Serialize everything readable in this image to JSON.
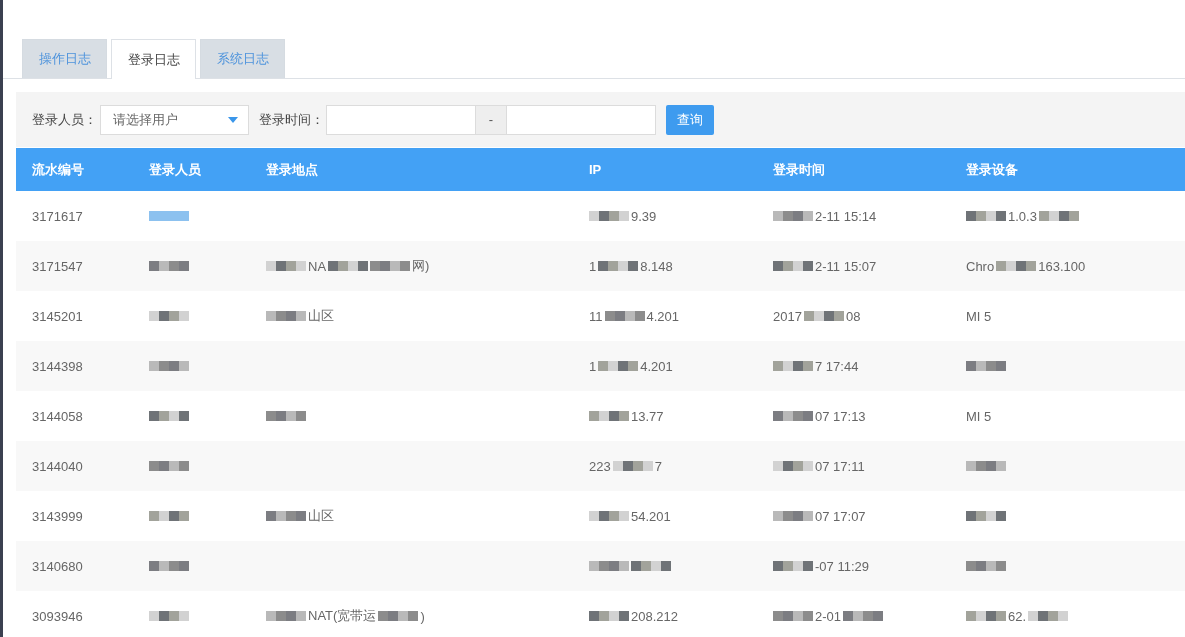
{
  "tabs": [
    {
      "label": "操作日志",
      "selected": false
    },
    {
      "label": "登录日志",
      "selected": true
    },
    {
      "label": "系统日志",
      "selected": false
    }
  ],
  "filters": {
    "user": {
      "label": "登录人员：",
      "placeholder": "请选择用户"
    },
    "time": {
      "label": "登录时间：",
      "separator": "-"
    },
    "search_button": "查询"
  },
  "table": {
    "columns": [
      "流水编号",
      "登录人员",
      "登录地点",
      "IP",
      "登录时间",
      "登录设备"
    ],
    "rows": [
      {
        "cells": [
          [
            {
              "kind": "text",
              "text": "3171617"
            }
          ],
          [
            {
              "kind": "link_mosaic"
            }
          ],
          [],
          [
            {
              "kind": "mosaic"
            },
            {
              "kind": "text",
              "text": "9.39"
            }
          ],
          [
            {
              "kind": "mosaic"
            },
            {
              "kind": "text",
              "text": "2-11 15:14"
            }
          ],
          [
            {
              "kind": "mosaic"
            },
            {
              "kind": "text",
              "text": "1.0.3"
            },
            {
              "kind": "mosaic"
            }
          ]
        ]
      },
      {
        "cells": [
          [
            {
              "kind": "text",
              "text": "3171547"
            }
          ],
          [
            {
              "kind": "mosaic"
            }
          ],
          [
            {
              "kind": "mosaic"
            },
            {
              "kind": "text",
              "text": "NA"
            },
            {
              "kind": "mosaic"
            },
            {
              "kind": "mosaic"
            },
            {
              "kind": "text",
              "text": "网)"
            }
          ],
          [
            {
              "kind": "text",
              "text": "1"
            },
            {
              "kind": "mosaic"
            },
            {
              "kind": "text",
              "text": "8.148"
            }
          ],
          [
            {
              "kind": "mosaic"
            },
            {
              "kind": "text",
              "text": "2-11 15:07"
            }
          ],
          [
            {
              "kind": "text",
              "text": "Chro"
            },
            {
              "kind": "mosaic"
            },
            {
              "kind": "text",
              "text": "163.100"
            }
          ]
        ]
      },
      {
        "cells": [
          [
            {
              "kind": "text",
              "text": "3145201"
            }
          ],
          [
            {
              "kind": "mosaic"
            }
          ],
          [
            {
              "kind": "mosaic"
            },
            {
              "kind": "text",
              "text": "山区"
            }
          ],
          [
            {
              "kind": "text",
              "text": "11"
            },
            {
              "kind": "mosaic"
            },
            {
              "kind": "text",
              "text": "4.201"
            }
          ],
          [
            {
              "kind": "text",
              "text": "2017"
            },
            {
              "kind": "mosaic"
            },
            {
              "kind": "text",
              "text": "08"
            }
          ],
          [
            {
              "kind": "text",
              "text": "MI 5"
            }
          ]
        ]
      },
      {
        "cells": [
          [
            {
              "kind": "text",
              "text": "3144398"
            }
          ],
          [
            {
              "kind": "mosaic"
            }
          ],
          [],
          [
            {
              "kind": "text",
              "text": "1"
            },
            {
              "kind": "mosaic"
            },
            {
              "kind": "text",
              "text": "4.201"
            }
          ],
          [
            {
              "kind": "mosaic"
            },
            {
              "kind": "text",
              "text": "7 17:44"
            }
          ],
          [
            {
              "kind": "mosaic"
            }
          ]
        ]
      },
      {
        "cells": [
          [
            {
              "kind": "text",
              "text": "3144058"
            }
          ],
          [
            {
              "kind": "mosaic"
            }
          ],
          [
            {
              "kind": "mosaic"
            }
          ],
          [
            {
              "kind": "mosaic"
            },
            {
              "kind": "text",
              "text": "13.77"
            }
          ],
          [
            {
              "kind": "mosaic"
            },
            {
              "kind": "text",
              "text": "07 17:13"
            }
          ],
          [
            {
              "kind": "text",
              "text": "MI 5"
            }
          ]
        ]
      },
      {
        "cells": [
          [
            {
              "kind": "text",
              "text": "3144040"
            }
          ],
          [
            {
              "kind": "mosaic"
            }
          ],
          [],
          [
            {
              "kind": "text",
              "text": "223"
            },
            {
              "kind": "mosaic"
            },
            {
              "kind": "text",
              "text": "7"
            }
          ],
          [
            {
              "kind": "mosaic"
            },
            {
              "kind": "text",
              "text": "07 17:11"
            }
          ],
          [
            {
              "kind": "mosaic"
            }
          ]
        ]
      },
      {
        "cells": [
          [
            {
              "kind": "text",
              "text": "3143999"
            }
          ],
          [
            {
              "kind": "mosaic"
            }
          ],
          [
            {
              "kind": "mosaic"
            },
            {
              "kind": "text",
              "text": "山区"
            }
          ],
          [
            {
              "kind": "mosaic"
            },
            {
              "kind": "text",
              "text": "54.201"
            }
          ],
          [
            {
              "kind": "mosaic"
            },
            {
              "kind": "text",
              "text": "07 17:07"
            }
          ],
          [
            {
              "kind": "mosaic"
            }
          ]
        ]
      },
      {
        "cells": [
          [
            {
              "kind": "text",
              "text": "3140680"
            }
          ],
          [
            {
              "kind": "mosaic"
            }
          ],
          [],
          [
            {
              "kind": "mosaic"
            },
            {
              "kind": "mosaic"
            }
          ],
          [
            {
              "kind": "mosaic"
            },
            {
              "kind": "text",
              "text": "-07 11:29"
            }
          ],
          [
            {
              "kind": "mosaic"
            }
          ]
        ]
      },
      {
        "cells": [
          [
            {
              "kind": "text",
              "text": "3093946"
            }
          ],
          [
            {
              "kind": "mosaic"
            }
          ],
          [
            {
              "kind": "mosaic"
            },
            {
              "kind": "text",
              "text": "NAT(宽带运"
            },
            {
              "kind": "mosaic"
            },
            {
              "kind": "text",
              "text": ")"
            }
          ],
          [
            {
              "kind": "mosaic"
            },
            {
              "kind": "text",
              "text": "208.212"
            }
          ],
          [
            {
              "kind": "mosaic"
            },
            {
              "kind": "text",
              "text": "2-01"
            },
            {
              "kind": "mosaic"
            }
          ],
          [
            {
              "kind": "mosaic"
            },
            {
              "kind": "text",
              "text": "62."
            },
            {
              "kind": "mosaic"
            }
          ]
        ]
      }
    ]
  }
}
